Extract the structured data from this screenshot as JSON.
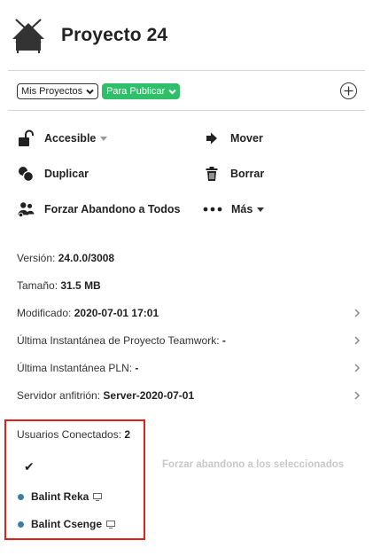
{
  "header": {
    "title": "Proyecto 24",
    "icon": "house-icon"
  },
  "toolbar": {
    "project_filter": "Mis Proyectos",
    "publish_status": "Para Publicar",
    "publish_color": "#2ebf68",
    "add_icon": "plus-circle-icon"
  },
  "actions": {
    "accesible": "Accesible",
    "mover": "Mover",
    "duplicar": "Duplicar",
    "borrar": "Borrar",
    "forzar_todos": "Forzar Abandono a Todos",
    "mas": "Más"
  },
  "info": {
    "version_label": "Versión:",
    "version_value": "24.0.0/3008",
    "size_label": "Tamaño:",
    "size_value": "31.5 MB",
    "modified_label": "Modificado:",
    "modified_value": "2020-07-01 17:01",
    "teamwork_label": "Última Instantánea de Proyecto Teamwork:",
    "teamwork_value": "-",
    "pln_label": "Última Instantánea PLN:",
    "pln_value": "-",
    "server_label": "Servidor anfitrión:",
    "server_value": "Server-2020-07-01"
  },
  "users": {
    "label": "Usuarios Conectados:",
    "count": "2",
    "check_mark": "✔",
    "force_selected": "Forzar abandono a los seleccionados",
    "dot_color": "#3d7da3",
    "list": [
      {
        "name": "Balint Reka"
      },
      {
        "name": "Balint Csenge"
      }
    ]
  }
}
